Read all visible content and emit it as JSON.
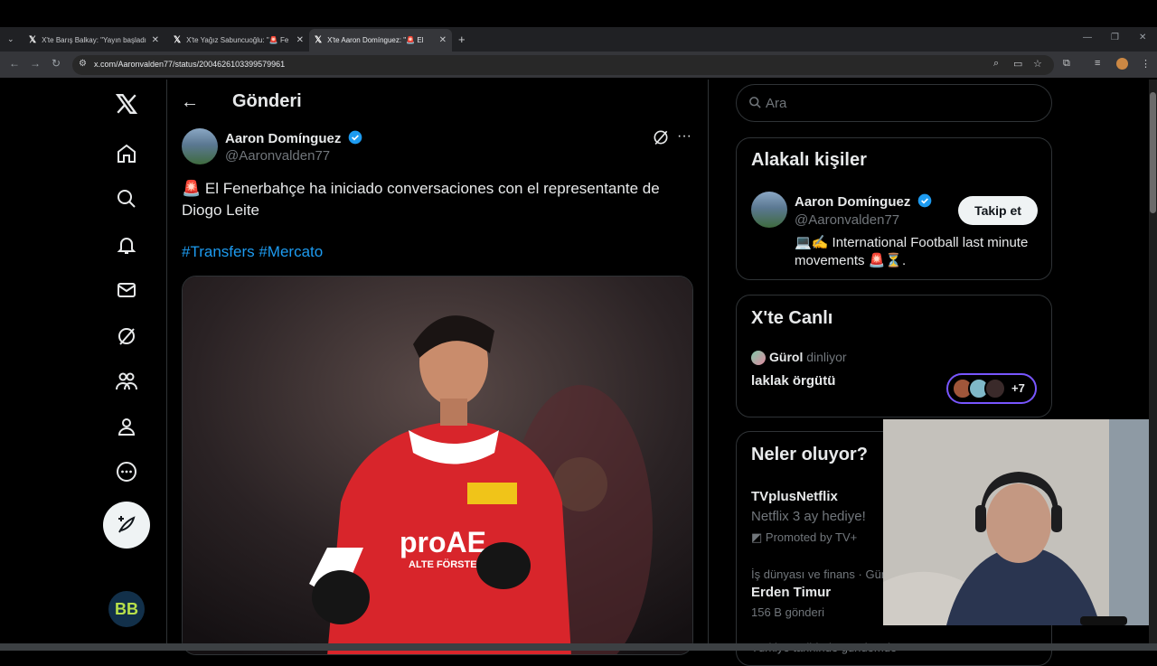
{
  "browser": {
    "tabs": [
      {
        "label": "X'te Barış Balkay: \"Yayın başladı"
      },
      {
        "label": "X'te Yağız Sabuncuoğlu: \"🚨 Fe"
      },
      {
        "label": "X'te Aaron Domínguez: \"🚨 El"
      }
    ],
    "new_tab": "+",
    "url": "x.com/Aaronvalden77/status/2004626103399579961"
  },
  "header": {
    "title": "Gönderi"
  },
  "post": {
    "author_name": "Aaron Domínguez",
    "author_handle": "@Aaronvalden77",
    "text": "🚨 El Fenerbahçe ha iniciado conversaciones con el representante de Diogo Leite",
    "hashtags": "#Transfers #Mercato",
    "more": "···"
  },
  "search": {
    "placeholder": "Ara"
  },
  "related": {
    "title": "Alakalı kişiler",
    "name": "Aaron Domínguez",
    "handle": "@Aaronvalden77",
    "follow_label": "Takip et",
    "bio": "💻✍️ International Football last minute movements 🚨⏳."
  },
  "live": {
    "title": "X'te Canlı",
    "host": "Gürol",
    "host_status": "dinliyor",
    "space_title": "laklak örgütü",
    "listener_extra": "+7"
  },
  "trends": {
    "title": "Neler oluyor?",
    "items": [
      {
        "title": "TVplusNetflix",
        "sub": "Netflix 3 ay hediye!",
        "meta": "Promoted by TV+"
      },
      {
        "context": "İş dünyası ve finans · Gün",
        "title": "Erden Timur",
        "meta": "156 B gönderi"
      },
      {
        "context": "Türkiye tarihinde gündemde"
      }
    ]
  },
  "colors": {
    "accent": "#1d9bf0",
    "background": "#000000",
    "verified": "#1d9bf0"
  }
}
